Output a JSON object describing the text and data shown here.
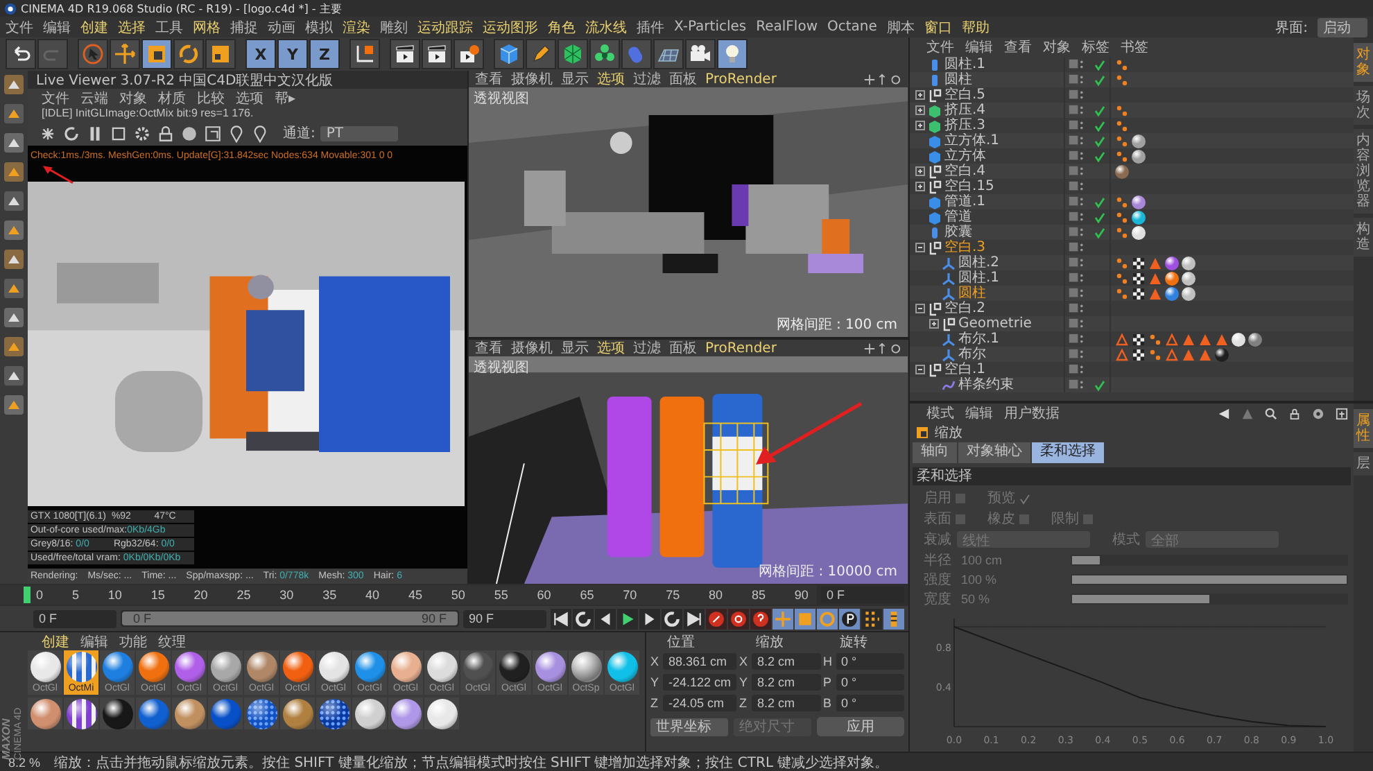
{
  "window": {
    "title": "CINEMA 4D R19.068 Studio (RC - R19) - [logo.c4d *] - 主要"
  },
  "menu": [
    {
      "label": "文件",
      "highlight": false
    },
    {
      "label": "编辑",
      "highlight": false
    },
    {
      "label": "创建",
      "highlight": true
    },
    {
      "label": "选择",
      "highlight": true
    },
    {
      "label": "工具",
      "highlight": false
    },
    {
      "label": "网格",
      "highlight": true
    },
    {
      "label": "捕捉",
      "highlight": false
    },
    {
      "label": "动画",
      "highlight": false
    },
    {
      "label": "模拟",
      "highlight": false
    },
    {
      "label": "渲染",
      "highlight": true
    },
    {
      "label": "雕刻",
      "highlight": false
    },
    {
      "label": "运动跟踪",
      "highlight": true
    },
    {
      "label": "运动图形",
      "highlight": true
    },
    {
      "label": "角色",
      "highlight": true
    },
    {
      "label": "流水线",
      "highlight": true
    },
    {
      "label": "插件",
      "highlight": false
    },
    {
      "label": "X-Particles",
      "highlight": false
    },
    {
      "label": "RealFlow",
      "highlight": false
    },
    {
      "label": "Octane",
      "highlight": false
    },
    {
      "label": "脚本",
      "highlight": false
    },
    {
      "label": "窗口",
      "highlight": true
    },
    {
      "label": "帮助",
      "highlight": true
    }
  ],
  "layout": {
    "label": "界面:",
    "value": "启动"
  },
  "toolbar": [
    {
      "kind": "undo",
      "selected": false
    },
    {
      "kind": "redo",
      "selected": false
    },
    {
      "kind": "select",
      "selected": false
    },
    {
      "kind": "move",
      "selected": false
    },
    {
      "kind": "scale",
      "selected": true
    },
    {
      "kind": "rotate",
      "selected": false
    },
    {
      "kind": "recent",
      "selected": false
    },
    {
      "kind": "axis",
      "label": "X",
      "selected": true
    },
    {
      "kind": "axis",
      "label": "Y",
      "selected": true
    },
    {
      "kind": "axis",
      "label": "Z",
      "selected": true
    },
    {
      "kind": "coords",
      "selected": false
    },
    {
      "kind": "render",
      "selected": false
    },
    {
      "kind": "render",
      "selected": false
    },
    {
      "kind": "render-settings",
      "selected": false
    },
    {
      "kind": "cube",
      "selected": false
    },
    {
      "kind": "pen",
      "selected": false
    },
    {
      "kind": "subdiv",
      "selected": false
    },
    {
      "kind": "cloner",
      "selected": false
    },
    {
      "kind": "deformer",
      "selected": false
    },
    {
      "kind": "floor",
      "selected": false
    },
    {
      "kind": "camera",
      "selected": false
    },
    {
      "kind": "light",
      "selected": true
    }
  ],
  "live_viewer": {
    "title": "Live Viewer 3.07-R2 中国C4D联盟中文汉化版",
    "menu": [
      "文件",
      "云端",
      "对象",
      "材质",
      "比较",
      "选项",
      "帮▸"
    ],
    "status": "[IDLE] InitGLImage:OctMix  bit:9 res=1  176.",
    "channel_label": "通道:",
    "channel": "PT",
    "log": "Check:1ms./3ms. MeshGen:0ms. Update[G]:31.842sec Nodes:634 Movable:301  0 0",
    "stats": [
      {
        "cells": [
          {
            "label": "GTX 1080[T](6.1)"
          },
          {
            "label": "%92"
          },
          {
            "label": "47°C"
          }
        ]
      },
      {
        "cells": [
          {
            "label": "Out-of-core used/max:",
            "value": "0Kb/4Gb"
          }
        ]
      },
      {
        "cells": [
          {
            "label": "Grey8/16: ",
            "value": "0/0"
          },
          {
            "label": "Rgb32/64: ",
            "value": "0/0"
          }
        ]
      },
      {
        "cells": [
          {
            "label": "Used/free/total vram: ",
            "value": "0Kb/0Kb/0Kb"
          }
        ]
      }
    ],
    "rendering": [
      {
        "label": "Rendering:"
      },
      {
        "label": "Ms/sec: ..."
      },
      {
        "label": "Time: ..."
      },
      {
        "label": "Spp/maxspp: ..."
      },
      {
        "label": "Tri: ",
        "value": "0/778k"
      },
      {
        "label": "Mesh: ",
        "value": "300"
      },
      {
        "label": "Hair: ",
        "value": "6"
      }
    ]
  },
  "viewports": [
    {
      "kind": "scene",
      "menu": [
        {
          "label": "查看",
          "highlight": false
        },
        {
          "label": "摄像机",
          "highlight": false
        },
        {
          "label": "显示",
          "highlight": false
        },
        {
          "label": "选项",
          "highlight": true
        },
        {
          "label": "过滤",
          "highlight": false
        },
        {
          "label": "面板",
          "highlight": false
        },
        {
          "label": "ProRender",
          "highlight": true
        }
      ],
      "label": "透视视图",
      "grid": "网格间距 : 100 cm"
    },
    {
      "kind": "closeup",
      "menu": [
        {
          "label": "查看",
          "highlight": false
        },
        {
          "label": "摄像机",
          "highlight": false
        },
        {
          "label": "显示",
          "highlight": false
        },
        {
          "label": "选项",
          "highlight": true
        },
        {
          "label": "过滤",
          "highlight": false
        },
        {
          "label": "面板",
          "highlight": false
        },
        {
          "label": "ProRender",
          "highlight": true
        }
      ],
      "label": "透视视图",
      "grid": "网格间距 : 10000 cm"
    }
  ],
  "timeline": {
    "ticks": [
      "0",
      "5",
      "10",
      "15",
      "20",
      "25",
      "30",
      "35",
      "40",
      "45",
      "50",
      "55",
      "60",
      "65",
      "70",
      "75",
      "80",
      "85",
      "90"
    ],
    "level": 0,
    "current": "0 F"
  },
  "playback": {
    "start": "0 F",
    "range": {
      "start": "0 F",
      "end": "90 F",
      "level": 1
    },
    "end": "90 F"
  },
  "materials": {
    "menu": [
      {
        "label": "创建",
        "highlight": true
      },
      {
        "label": "编辑",
        "highlight": false
      },
      {
        "label": "功能",
        "highlight": false
      },
      {
        "label": "纹理",
        "highlight": false
      }
    ],
    "logo": {
      "brand": "MAXON",
      "product": "CINEMA 4D"
    },
    "rows": [
      {
        "items": [
          {
            "label": "OctGl",
            "color": "#e8e8e8",
            "kind": "plain",
            "selected": false
          },
          {
            "label": "OctMi",
            "color": "#2a6ad0",
            "kind": "striped",
            "selected": true
          },
          {
            "label": "OctGl",
            "color": "#1e7fe0",
            "kind": "plain",
            "selected": false
          },
          {
            "label": "OctGl",
            "color": "#f07010",
            "kind": "plain",
            "selected": false
          },
          {
            "label": "OctGl",
            "color": "#b060e8",
            "kind": "plain",
            "selected": false
          },
          {
            "label": "OctGl",
            "color": "#a8a8a8",
            "kind": "plain",
            "selected": false
          },
          {
            "label": "OctGl",
            "color": "#b08868",
            "kind": "plain",
            "selected": false
          },
          {
            "label": "OctGl",
            "color": "#f06010",
            "kind": "plain",
            "selected": false
          },
          {
            "label": "OctGl",
            "color": "#e4e4e4",
            "kind": "plain",
            "selected": false
          },
          {
            "label": "OctGl",
            "color": "#1e90e8",
            "kind": "plain",
            "selected": false
          },
          {
            "label": "OctGl",
            "color": "#e8b090",
            "kind": "plain",
            "selected": false
          },
          {
            "label": "OctGl",
            "color": "#dcdcdc",
            "kind": "plain",
            "selected": false
          },
          {
            "label": "OctGl",
            "color": "#505050",
            "kind": "plain",
            "selected": false
          },
          {
            "label": "OctGl",
            "color": "#202020",
            "kind": "plain",
            "selected": false
          },
          {
            "label": "OctGl",
            "color": "#a890e0",
            "kind": "plain",
            "selected": false
          },
          {
            "label": "OctSp",
            "color": "#c8c8c8",
            "kind": "glass",
            "selected": false
          },
          {
            "label": "OctGl",
            "color": "#10c0e8",
            "kind": "plain",
            "selected": false
          }
        ]
      },
      {
        "items": [
          {
            "color": "#d09070",
            "kind": "plain",
            "selected": false
          },
          {
            "color": "#8040d0",
            "kind": "striped",
            "selected": false
          },
          {
            "color": "#181818",
            "kind": "plain",
            "selected": false
          },
          {
            "color": "#1060d0",
            "kind": "plain",
            "selected": false
          },
          {
            "color": "#c09060",
            "kind": "plain",
            "selected": false
          },
          {
            "color": "#0850c8",
            "kind": "plain",
            "selected": false
          },
          {
            "color": "#1050c0",
            "kind": "dotted",
            "selected": false
          },
          {
            "color": "#b08040",
            "kind": "plain",
            "selected": false
          },
          {
            "color": "#0838a0",
            "kind": "dotted",
            "selected": false
          },
          {
            "color": "#d0d0d0",
            "kind": "plain",
            "selected": false
          },
          {
            "color": "#b098e8",
            "kind": "plain",
            "selected": false
          },
          {
            "color": "#e8e8e8",
            "kind": "plain",
            "selected": false
          }
        ]
      }
    ]
  },
  "coordinates": {
    "columns": [
      {
        "title": "位置",
        "fields": [
          {
            "axis": "X",
            "value": "88.361 cm"
          },
          {
            "axis": "Y",
            "value": "-24.122 cm"
          },
          {
            "axis": "Z",
            "value": "-24.05 cm"
          }
        ]
      },
      {
        "title": "缩放",
        "fields": [
          {
            "axis": "X",
            "value": "8.2 cm"
          },
          {
            "axis": "Y",
            "value": "8.2 cm"
          },
          {
            "axis": "Z",
            "value": "8.2 cm"
          }
        ]
      },
      {
        "title": "旋转",
        "fields": [
          {
            "axis": "H",
            "value": "0 °"
          },
          {
            "axis": "P",
            "value": "0 °"
          },
          {
            "axis": "B",
            "value": "0 °"
          }
        ]
      }
    ],
    "space": "世界坐标",
    "size_mode": {
      "value": "绝对尺寸",
      "disabled": true
    },
    "apply": "应用"
  },
  "objects": {
    "menu": [
      "文件",
      "编辑",
      "查看",
      "对象",
      "标签",
      "书签"
    ],
    "side_tabs": [
      {
        "label": "对象",
        "selected": true
      },
      {
        "label": "场次",
        "selected": false
      },
      {
        "label": "内容浏览器",
        "selected": false
      },
      {
        "label": "构造",
        "selected": false
      }
    ],
    "items": [
      {
        "name": "圆柱.1",
        "kind": "cylinder",
        "selected": false,
        "checked": true,
        "tags": [
          {
            "kind": "phong"
          }
        ]
      },
      {
        "name": "圆柱",
        "kind": "cylinder",
        "selected": false,
        "checked": true,
        "tags": [
          {
            "kind": "phong"
          }
        ]
      },
      {
        "name": "空白.5",
        "kind": "null",
        "expanded": false,
        "selected": false,
        "checked": false
      },
      {
        "name": "挤压.4",
        "kind": "extrude",
        "expanded": false,
        "selected": false,
        "checked": true,
        "tags": [
          {
            "kind": "phong"
          }
        ]
      },
      {
        "name": "挤压.3",
        "kind": "extrude",
        "expanded": false,
        "selected": false,
        "checked": true,
        "tags": [
          {
            "kind": "phong"
          }
        ]
      },
      {
        "name": "立方体.1",
        "kind": "cube",
        "selected": false,
        "checked": true,
        "tags": [
          {
            "kind": "phong"
          },
          {
            "kind": "material",
            "color": "#a0a0a0"
          }
        ]
      },
      {
        "name": "立方体",
        "kind": "cube",
        "selected": false,
        "checked": true,
        "tags": [
          {
            "kind": "phong"
          },
          {
            "kind": "material",
            "color": "#a0a0a0"
          }
        ]
      },
      {
        "name": "空白.4",
        "kind": "null",
        "expanded": false,
        "selected": false,
        "checked": false,
        "tags": [
          {
            "kind": "material",
            "color": "#8a6a50"
          }
        ]
      },
      {
        "name": "空白.15",
        "kind": "null",
        "expanded": false,
        "selected": false,
        "checked": false
      },
      {
        "name": "管道.1",
        "kind": "tube",
        "selected": false,
        "checked": true,
        "tags": [
          {
            "kind": "phong"
          },
          {
            "kind": "material",
            "color": "#a987d8"
          }
        ]
      },
      {
        "name": "管道",
        "kind": "tube",
        "selected": false,
        "checked": true,
        "tags": [
          {
            "kind": "phong"
          },
          {
            "kind": "material",
            "color": "#19b6d8"
          }
        ]
      },
      {
        "name": "胶囊",
        "kind": "capsule",
        "selected": false,
        "checked": true,
        "tags": [
          {
            "kind": "phong"
          },
          {
            "kind": "material",
            "color": "#e0e0e0"
          }
        ]
      },
      {
        "name": "空白.3",
        "kind": "null",
        "expanded": true,
        "selected": true,
        "checked": false,
        "children": [
          {
            "name": "圆柱.2",
            "kind": "instance",
            "selected": false,
            "checked": false,
            "tags": [
              {
                "kind": "phong"
              },
              {
                "kind": "uv"
              },
              {
                "kind": "alert"
              },
              {
                "kind": "material",
                "color": "#a050e0"
              },
              {
                "kind": "material",
                "color": "#c0c0c0"
              }
            ]
          },
          {
            "name": "圆柱.1",
            "kind": "instance",
            "selected": false,
            "checked": false,
            "tags": [
              {
                "kind": "phong"
              },
              {
                "kind": "uv"
              },
              {
                "kind": "alert"
              },
              {
                "kind": "material",
                "color": "#f07010"
              },
              {
                "kind": "material",
                "color": "#c0c0c0"
              }
            ]
          },
          {
            "name": "圆柱",
            "kind": "instance",
            "selected": true,
            "checked": false,
            "tags": [
              {
                "kind": "phong"
              },
              {
                "kind": "uv"
              },
              {
                "kind": "alert"
              },
              {
                "kind": "material",
                "color": "#3080e0"
              },
              {
                "kind": "material",
                "color": "#c0c0c0"
              }
            ]
          }
        ]
      },
      {
        "name": "空白.2",
        "kind": "null",
        "expanded": true,
        "selected": false,
        "checked": false,
        "children": [
          {
            "name": "Geometrie",
            "kind": "null",
            "expanded": false,
            "selected": false,
            "checked": false
          },
          {
            "name": "布尔.1",
            "kind": "instance",
            "selected": false,
            "checked": false,
            "tags": [
              {
                "kind": "outline"
              },
              {
                "kind": "uv"
              },
              {
                "kind": "phong"
              },
              {
                "kind": "outline"
              },
              {
                "kind": "alert"
              },
              {
                "kind": "alert"
              },
              {
                "kind": "alert"
              },
              {
                "kind": "material",
                "color": "#e0e0e0"
              },
              {
                "kind": "material",
                "color": "#808080"
              }
            ]
          },
          {
            "name": "布尔",
            "kind": "instance",
            "selected": false,
            "checked": false,
            "tags": [
              {
                "kind": "outline"
              },
              {
                "kind": "uv"
              },
              {
                "kind": "phong"
              },
              {
                "kind": "outline"
              },
              {
                "kind": "alert"
              },
              {
                "kind": "alert"
              },
              {
                "kind": "material",
                "color": "#202020"
              }
            ]
          }
        ]
      },
      {
        "name": "空白.1",
        "kind": "null",
        "expanded": true,
        "selected": false,
        "checked": false,
        "children": [
          {
            "name": "样条约束",
            "kind": "spline",
            "selected": false,
            "checked": true
          }
        ]
      }
    ]
  },
  "attributes": {
    "menu": [
      "模式",
      "编辑",
      "用户数据"
    ],
    "object": "缩放",
    "tabs": [
      {
        "label": "轴向",
        "selected": false
      },
      {
        "label": "对象轴心",
        "selected": false
      },
      {
        "label": "柔和选择",
        "selected": true
      }
    ],
    "side_tabs": [
      {
        "label": "属性",
        "selected": true
      },
      {
        "label": "层",
        "selected": false
      }
    ],
    "section": "柔和选择",
    "disabled": true,
    "checkboxes": [
      {
        "label": "启用",
        "checked": false
      },
      {
        "label": "预览",
        "checked": true
      },
      {
        "label": "表面",
        "checked": false
      },
      {
        "label": "橡皮",
        "checked": false
      },
      {
        "label": "限制",
        "checked": false
      }
    ],
    "dropdowns": [
      {
        "label": "衰减",
        "value": "线性"
      },
      {
        "label": "模式",
        "value": "全部"
      }
    ],
    "sliders": [
      {
        "label": "半径",
        "value": "100 cm",
        "level": 0.1
      },
      {
        "label": "强度",
        "value": "100 %",
        "level": 1
      },
      {
        "label": "宽度",
        "value": "50 %",
        "level": 0.5
      }
    ],
    "chart_data": {
      "type": "line",
      "x": [
        0,
        0.1,
        0.2,
        0.3,
        0.4,
        0.5,
        0.6,
        0.7,
        0.8,
        0.9,
        1
      ],
      "values": [
        1,
        0.86,
        0.72,
        0.58,
        0.44,
        0.29,
        0.19,
        0.11,
        0.05,
        0.01,
        0
      ],
      "xlim": [
        0,
        1
      ],
      "ylim": [
        0,
        1
      ],
      "xticks": [
        {
          "value": 0,
          "label": "0.0"
        },
        {
          "value": 0.1,
          "label": "0.1"
        },
        {
          "value": 0.2,
          "label": "0.2"
        },
        {
          "value": 0.3,
          "label": "0.3"
        },
        {
          "value": 0.4,
          "label": "0.4"
        },
        {
          "value": 0.5,
          "label": "0.5"
        },
        {
          "value": 0.6,
          "label": "0.6"
        },
        {
          "value": 0.7,
          "label": "0.7"
        },
        {
          "value": 0.8,
          "label": "0.8"
        },
        {
          "value": 0.9,
          "label": "0.9"
        },
        {
          "value": 1,
          "label": "1.0"
        }
      ],
      "yticks": [
        0.4,
        0.8
      ]
    }
  },
  "status": {
    "zoom": "8.2 %",
    "message": "缩放：点击并拖动鼠标缩放元素。按住 SHIFT 键量化缩放；节点编辑模式时按住 SHIFT 键增加选择对象；按住 CTRL 键减少选择对象。"
  }
}
